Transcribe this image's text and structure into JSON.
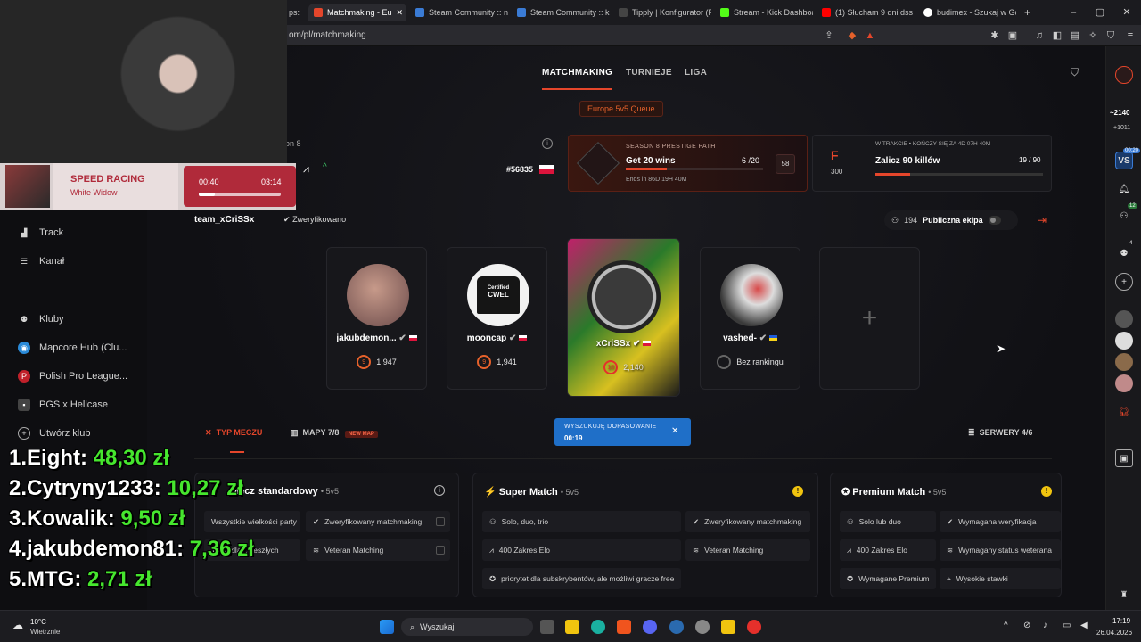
{
  "browser": {
    "tabs": [
      {
        "label": "ps:",
        "active": false
      },
      {
        "label": "Matchmaking - Eu",
        "active": true
      },
      {
        "label": "Steam Community :: ni",
        "active": false
      },
      {
        "label": "Steam Community :: ki",
        "active": false
      },
      {
        "label": "Tipply | Konfigurator (F",
        "active": false
      },
      {
        "label": "Stream - Kick Dashboa",
        "active": false
      },
      {
        "label": "(1) Słucham 9 dni dss",
        "active": false
      },
      {
        "label": "budimex - Szukaj w Go",
        "active": false
      }
    ],
    "url": "om/pl/matchmaking",
    "new_tab": "+"
  },
  "nav": {
    "matchmaking": "MATCHMAKING",
    "turnieje": "TURNIEJE",
    "liga": "LIGA"
  },
  "queue": {
    "label": "Europe 5v5 Queue"
  },
  "season": {
    "label": "on 8",
    "rank": "#56835"
  },
  "prestige": {
    "header": "SEASON 8 PRESTIGE PATH",
    "goal": "Get 20 wins",
    "progress": "6 /20",
    "level": "58",
    "ends": "Ends in 86D 19H 40M",
    "progress_value": 0.3
  },
  "challenge": {
    "grade": "F",
    "points": "300",
    "status": "W TRAKCIE • KOŃCZY SIĘ ZA 4D 07H 40M",
    "goal": "Zalicz 90 killów",
    "progress": "19 / 90",
    "progress_value": 0.21
  },
  "team": {
    "name": "team_xCriSSx",
    "verified": "Zweryfikowano",
    "members_count": "194",
    "public_label": "Publiczna ekipa"
  },
  "players": [
    {
      "name": "jakubdemon...",
      "level": "9",
      "elo": "1,947",
      "flag": "PL"
    },
    {
      "name": "mooncap",
      "level": "9",
      "elo": "1,941",
      "flag": "PL"
    },
    {
      "name": "xCriSSx",
      "level": "10",
      "elo": "2,140",
      "flag": "PL"
    },
    {
      "name": "vashed-",
      "level": "",
      "elo": "Bez rankingu",
      "flag": "UA"
    }
  ],
  "avatar_labels": {
    "mooncap_shirt": "CWEL",
    "mooncap_small": "Certified"
  },
  "add_slot": "+",
  "filters": {
    "match_type": "TYP MECZU",
    "maps": "MAPY 7/8",
    "new_map": "NEW MAP",
    "servers": "SERWERY 4/6"
  },
  "searching": {
    "label": "WYSZUKUJĘ DOPASOWANIE",
    "time": "00:19",
    "close": "✕"
  },
  "modes": [
    {
      "title": "Mecz standardowy",
      "size": "5v5",
      "options": [
        "Wszystkie wielkości party",
        "Zweryfikowany matchmaking",
        "Tylko dla... zeszłych",
        "Veteran Matching"
      ]
    },
    {
      "title": "Super Match",
      "size": "5v5",
      "options": [
        "Solo, duo, trio",
        "Zweryfikowany matchmaking",
        "400 Zakres Elo",
        "Veteran Matching",
        "priorytet dla subskrybentów, ale możliwi gracze free"
      ]
    },
    {
      "title": "Premium Match",
      "size": "5v5",
      "options": [
        "Solo lub duo",
        "Wymagana weryfikacja",
        "400 Zakres Elo",
        "Wymagany status weterana",
        "Wymagane Premium",
        "Wysokie stawki"
      ]
    }
  ],
  "sidebar": {
    "items": [
      {
        "label": "Track",
        "icon": "chart-icon"
      },
      {
        "label": "Kanał",
        "icon": "list-icon"
      },
      {
        "label": "Kluby",
        "icon": "person-icon"
      },
      {
        "label": "Mapcore Hub (Clu...",
        "icon": "mapcore-icon"
      },
      {
        "label": "Polish Pro League...",
        "icon": "ppl-icon"
      },
      {
        "label": "PGS x Hellcase",
        "icon": "pgs-icon"
      },
      {
        "label": "Utwórz klub",
        "icon": "plus-circle-icon"
      }
    ]
  },
  "music": {
    "title": "SPEED RACING",
    "artist": "White Widow",
    "elapsed": "00:40",
    "total": "03:14",
    "progress": 0.2
  },
  "leaderboard": [
    {
      "rank": "1.",
      "name": "Eight:",
      "amount": "48,30 zł"
    },
    {
      "rank": "2.",
      "name": "Cytryny1233:",
      "amount": "10,27 zł"
    },
    {
      "rank": "3.",
      "name": "Kowalik:",
      "amount": "9,50 zł"
    },
    {
      "rank": "4.",
      "name": "jakubdemon81:",
      "amount": "7,36 zł"
    },
    {
      "rank": "5.",
      "name": "MTG:",
      "amount": "2,71 zł"
    }
  ],
  "rightbar": {
    "elo": "~2140",
    "elo_delta": "+1011",
    "vs_badge": "00:20",
    "count_badge": "12",
    "small_badge": "4"
  },
  "taskbar": {
    "temp": "10°C",
    "weather": "Wietrznie",
    "search": "Wyszukaj",
    "time": "17:19",
    "date": "26.04.2026"
  },
  "colors": {
    "accent": "#e5462b",
    "searching": "#1f6fc8",
    "money": "#46e62e"
  }
}
